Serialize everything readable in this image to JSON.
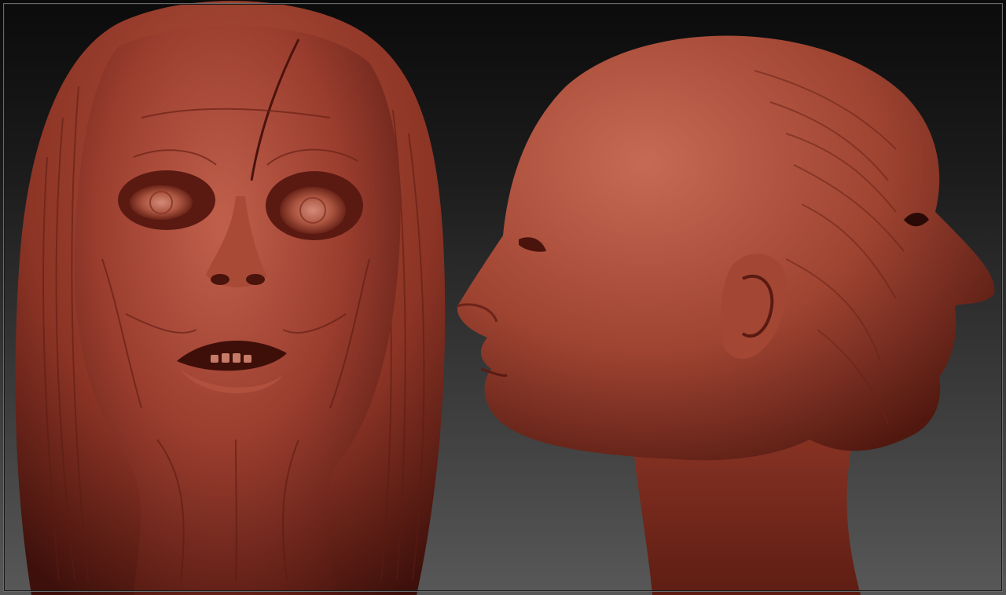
{
  "scene": {
    "background_top": "#0b0b0b",
    "background_bottom": "#585858",
    "clay_base": "#9c3e2f",
    "clay_light": "#c0604c",
    "clay_dark": "#5a1a12",
    "frame_color": "#6a6a6a"
  },
  "models": [
    {
      "id": "front-view",
      "icon": "sculpted-head-front-icon"
    },
    {
      "id": "profile-view",
      "icon": "sculpted-head-profile-icon"
    }
  ]
}
